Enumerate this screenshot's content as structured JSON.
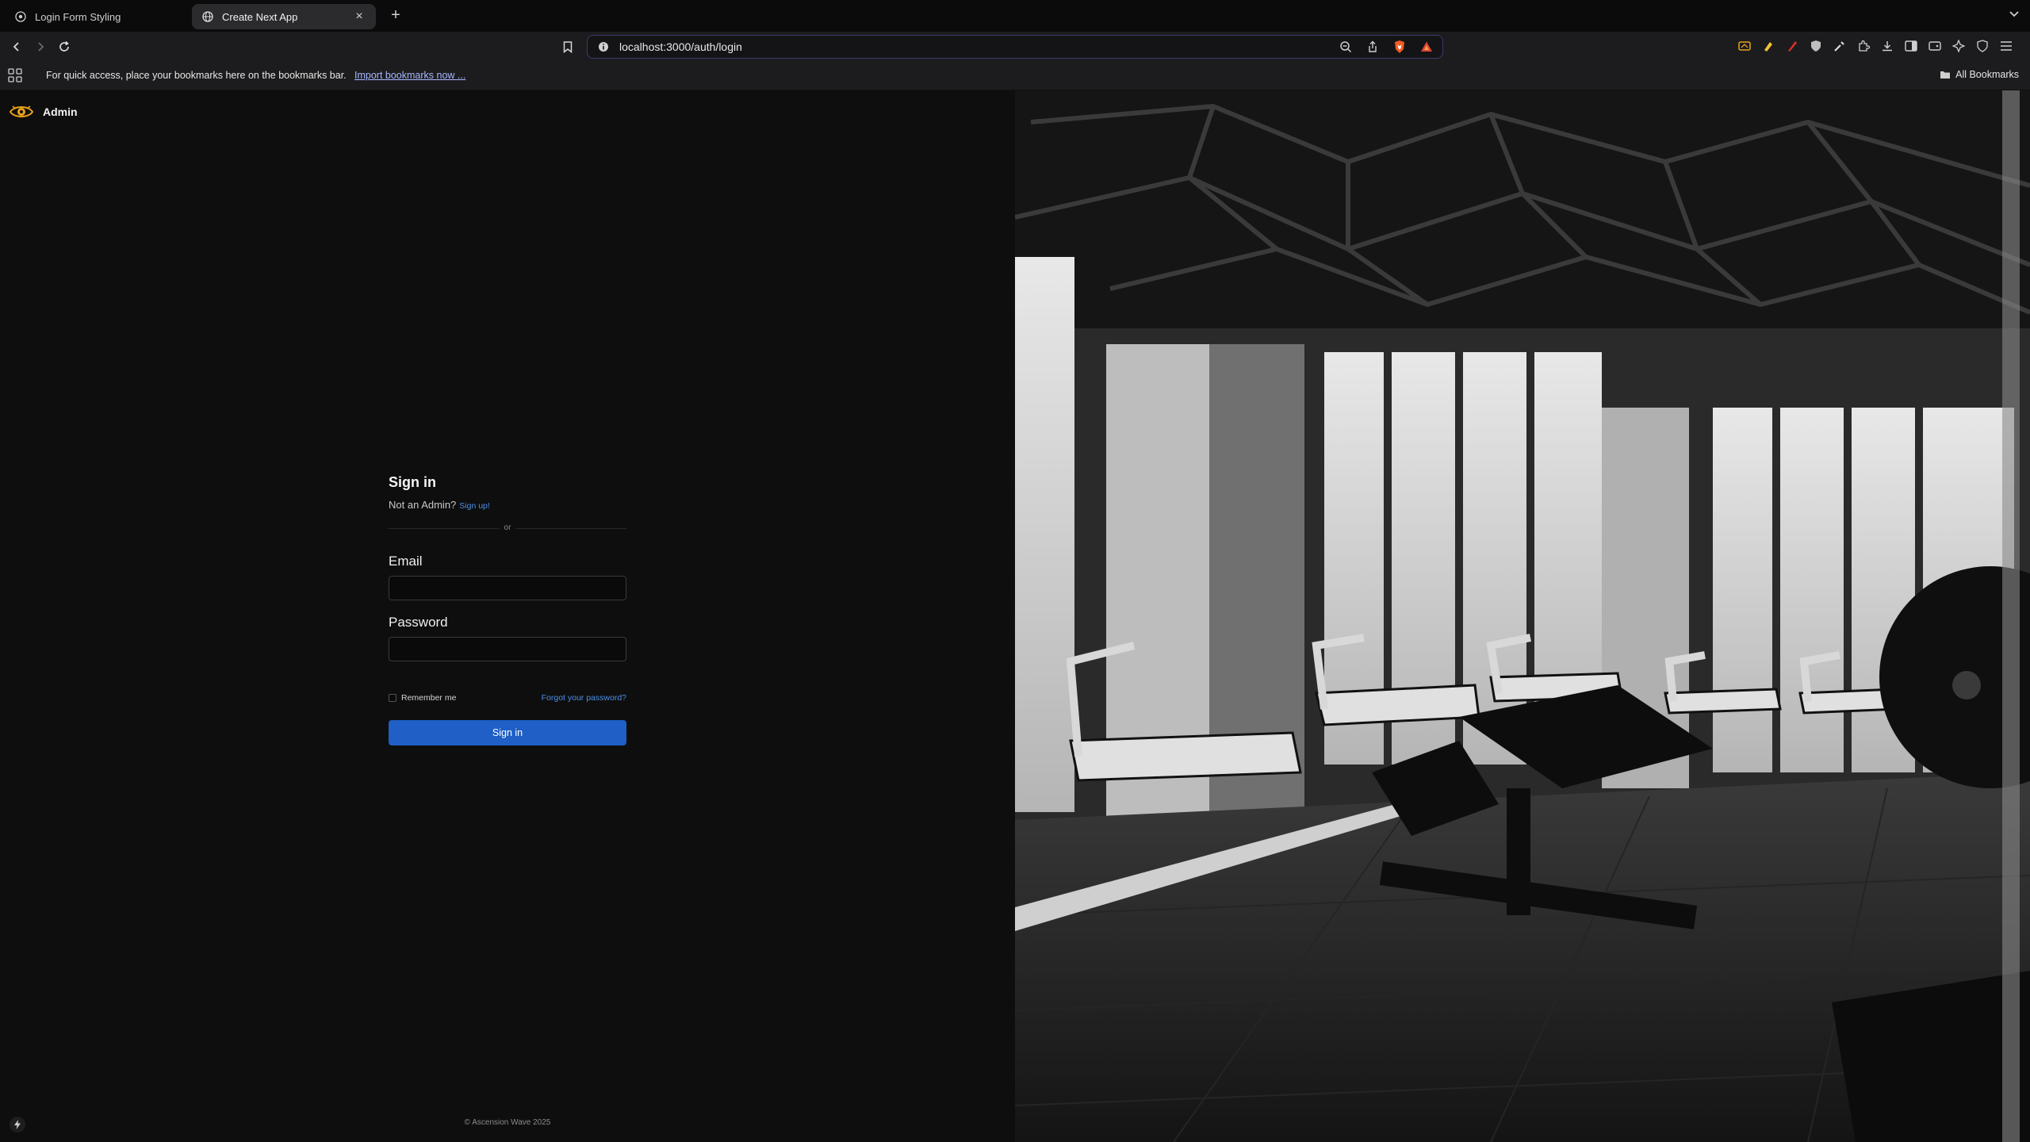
{
  "browser": {
    "tabs": [
      {
        "title": "Login Form Styling",
        "active": false
      },
      {
        "title": "Create Next App",
        "active": true
      }
    ],
    "url": "localhost:3000/auth/login",
    "bookmarks_bar": {
      "message": "For quick access, place your bookmarks here on the bookmarks bar.",
      "import_link": "Import bookmarks now ...",
      "all_bookmarks": "All Bookmarks"
    },
    "icons": [
      "back-icon",
      "forward-icon",
      "reload-icon",
      "bookmark-icon",
      "zoom-icon",
      "share-icon",
      "brave-shield-icon",
      "brave-rewards-icon",
      "wallet-icon",
      "extensions-icon",
      "downloads-icon",
      "sidebar-icon",
      "menu-icon"
    ],
    "accent_color": "#3b3a6e"
  },
  "page": {
    "brand": {
      "name": "Admin",
      "logo_color": "#e8a21a"
    },
    "form": {
      "heading": "Sign in",
      "prompt": "Not an Admin?",
      "signup_link": "Sign up!",
      "divider_text": "or",
      "email_label": "Email",
      "password_label": "Password",
      "remember_label": "Remember me",
      "forgot_link": "Forgot your password?",
      "submit_label": "Sign in",
      "button_color": "#1f5fc6"
    },
    "footer": {
      "copyright": "© Ascension Wave 2025"
    },
    "hero_image": "black-and-white gym interior with treadmills and benches"
  }
}
